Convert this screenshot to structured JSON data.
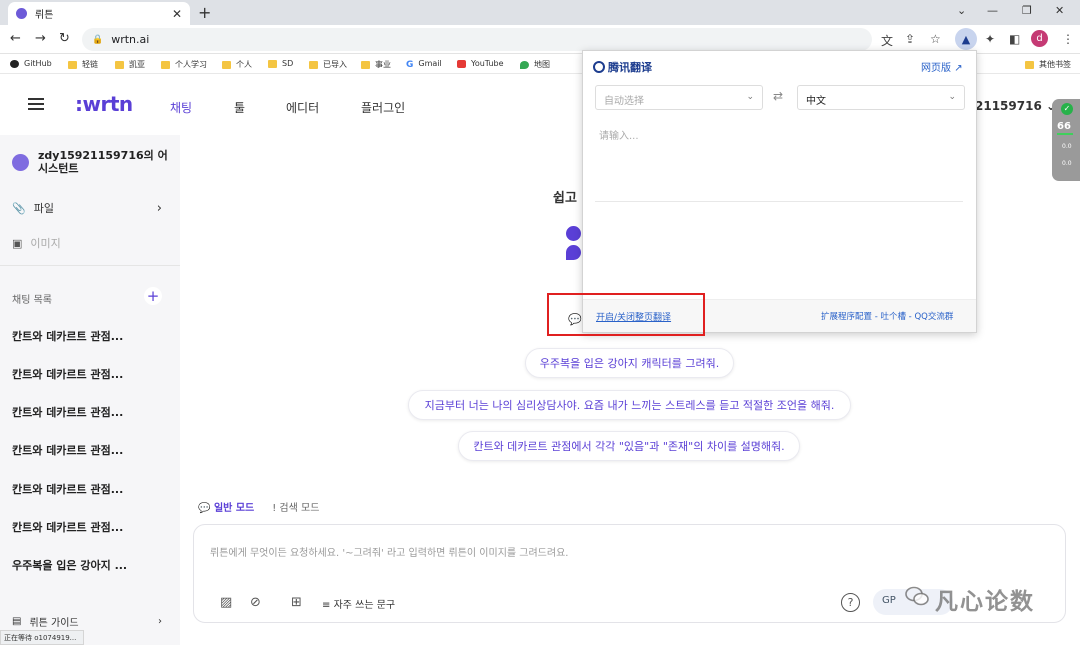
{
  "browser": {
    "tab_title": "뤼튼",
    "url": "wrtn.ai",
    "profile_initial": "d",
    "bookmarks": [
      "GitHub",
      "轻链",
      "凯亚",
      "个人学习",
      "个人",
      "SD",
      "已导入",
      "事业",
      "Gmail",
      "YouTube",
      "地图",
      "其他书签"
    ],
    "status_text": "正在等待 o1074919..."
  },
  "app": {
    "logo": ":wrtn",
    "nav_tabs": [
      "채팅",
      "툴",
      "에디터",
      "플러그인"
    ],
    "account_label": "21159716",
    "assistant_name": "zdy15921159716의 어시스턴트",
    "sidebar": {
      "file_label": "파일",
      "image_label": "이미지",
      "chat_list_header": "채팅 목록",
      "chats": [
        "칸트와 데카르트 관점...",
        "칸트와 데카르트 관점...",
        "칸트와 데카르트 관점...",
        "칸트와 데카르트 관점...",
        "칸트와 데카르트 관점...",
        "칸트와 데카르트 관점...",
        "우주복을 입은 강아지 ..."
      ],
      "guide_label": "뤼튼 가이드"
    },
    "main": {
      "headline": "쉽고",
      "suggestions": [
        "우주복을 입은 강아지 캐릭터를 그려줘.",
        "지금부터 너는 나의 심리상담사야. 요즘 내가 느끼는 스트레스를 듣고 적절한 조언을 해줘.",
        "칸트와 데카르트 관점에서 각각 \"있음\"과 \"존재\"의 차이를 설명해줘."
      ],
      "mode_general": "일반 모드",
      "mode_search": "검색 모드",
      "input_placeholder": "뤼튼에게 무엇이든 요청하세요.  '~그려줘' 라고 입력하면 뤼튼이 이미지를 그려드려요.",
      "phrase_label": "자주 쓰는 문구",
      "send_label": "GP"
    },
    "accent_color": "#5a3fd6"
  },
  "translator": {
    "brand": "腾讯翻译",
    "web_version": "网页版",
    "source_lang": "自动选择",
    "target_lang": "中文",
    "input_placeholder": "请输入...",
    "toggle_page_translate": "开启/关闭整页翻译",
    "footer_links": "扩展程序配置 - 吐个槽 - QQ交流群"
  },
  "widget": {
    "percent": "66",
    "up_speed": "0.0",
    "down_speed": "0.0"
  },
  "watermark": "凡心论数"
}
